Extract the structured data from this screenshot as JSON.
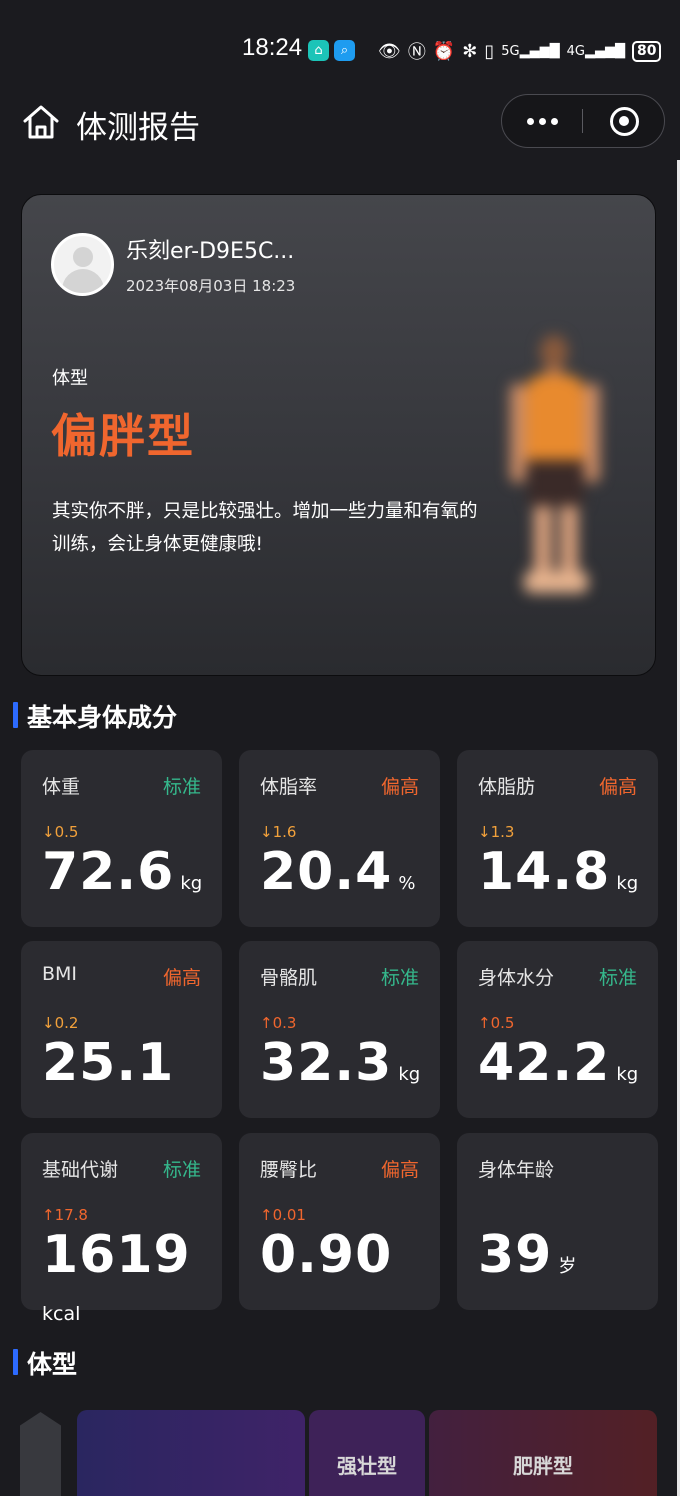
{
  "status_bar": {
    "time": "18:24",
    "battery": "80",
    "icons": [
      "home-app-icon",
      "search-app-icon",
      "eye-icon",
      "nfc-icon",
      "alarm-icon",
      "bluetooth-icon",
      "vibrate-icon",
      "signal-5g-icon",
      "signal-4g-icon",
      "battery-icon"
    ]
  },
  "header": {
    "title": "体测报告",
    "home_icon": "home-icon",
    "more_icon": "more-dots-icon",
    "close_icon": "close-miniprogram-icon"
  },
  "profile": {
    "name": "乐刻er-D9E5C...",
    "datetime": "2023年08月03日 18:23",
    "body_type_label": "体型",
    "body_type_value": "偏胖型",
    "description": "其实你不胖，只是比较强壮。增加一些力量和有氧的训练，会让身体更健康哦!",
    "accent_color": "#f0662e"
  },
  "basic_section": {
    "title": "基本身体成分",
    "metrics": [
      {
        "name": "体重",
        "status": "标准",
        "status_type": "ok",
        "change": "↓0.5",
        "change_dir": "down",
        "value": "72.6",
        "unit": "kg"
      },
      {
        "name": "体脂率",
        "status": "偏高",
        "status_type": "high",
        "change": "↓1.6",
        "change_dir": "down",
        "value": "20.4",
        "unit": "%"
      },
      {
        "name": "体脂肪",
        "status": "偏高",
        "status_type": "high",
        "change": "↓1.3",
        "change_dir": "down",
        "value": "14.8",
        "unit": "kg"
      },
      {
        "name": "BMI",
        "status": "偏高",
        "status_type": "high",
        "change": "↓0.2",
        "change_dir": "down",
        "value": "25.1",
        "unit": ""
      },
      {
        "name": "骨骼肌",
        "status": "标准",
        "status_type": "ok",
        "change": "↑0.3",
        "change_dir": "up",
        "value": "32.3",
        "unit": "kg"
      },
      {
        "name": "身体水分",
        "status": "标准",
        "status_type": "ok",
        "change": "↑0.5",
        "change_dir": "up",
        "value": "42.2",
        "unit": "kg"
      },
      {
        "name": "基础代谢",
        "status": "标准",
        "status_type": "ok",
        "change": "↑17.8",
        "change_dir": "up",
        "value": "1619",
        "unit": "kcal"
      },
      {
        "name": "腰臀比",
        "status": "偏高",
        "status_type": "high",
        "change": "↑0.01",
        "change_dir": "up",
        "value": "0.90",
        "unit": ""
      },
      {
        "name": "身体年龄",
        "status": "",
        "status_type": "",
        "change": "",
        "change_dir": "",
        "value": "39",
        "unit": "岁"
      }
    ],
    "status_colors": {
      "ok": "#35b88c",
      "high": "#f0662e"
    }
  },
  "body_type_section": {
    "title": "体型",
    "bars": [
      {
        "label": ""
      },
      {
        "label": "强壮型"
      },
      {
        "label": "肥胖型"
      }
    ]
  }
}
